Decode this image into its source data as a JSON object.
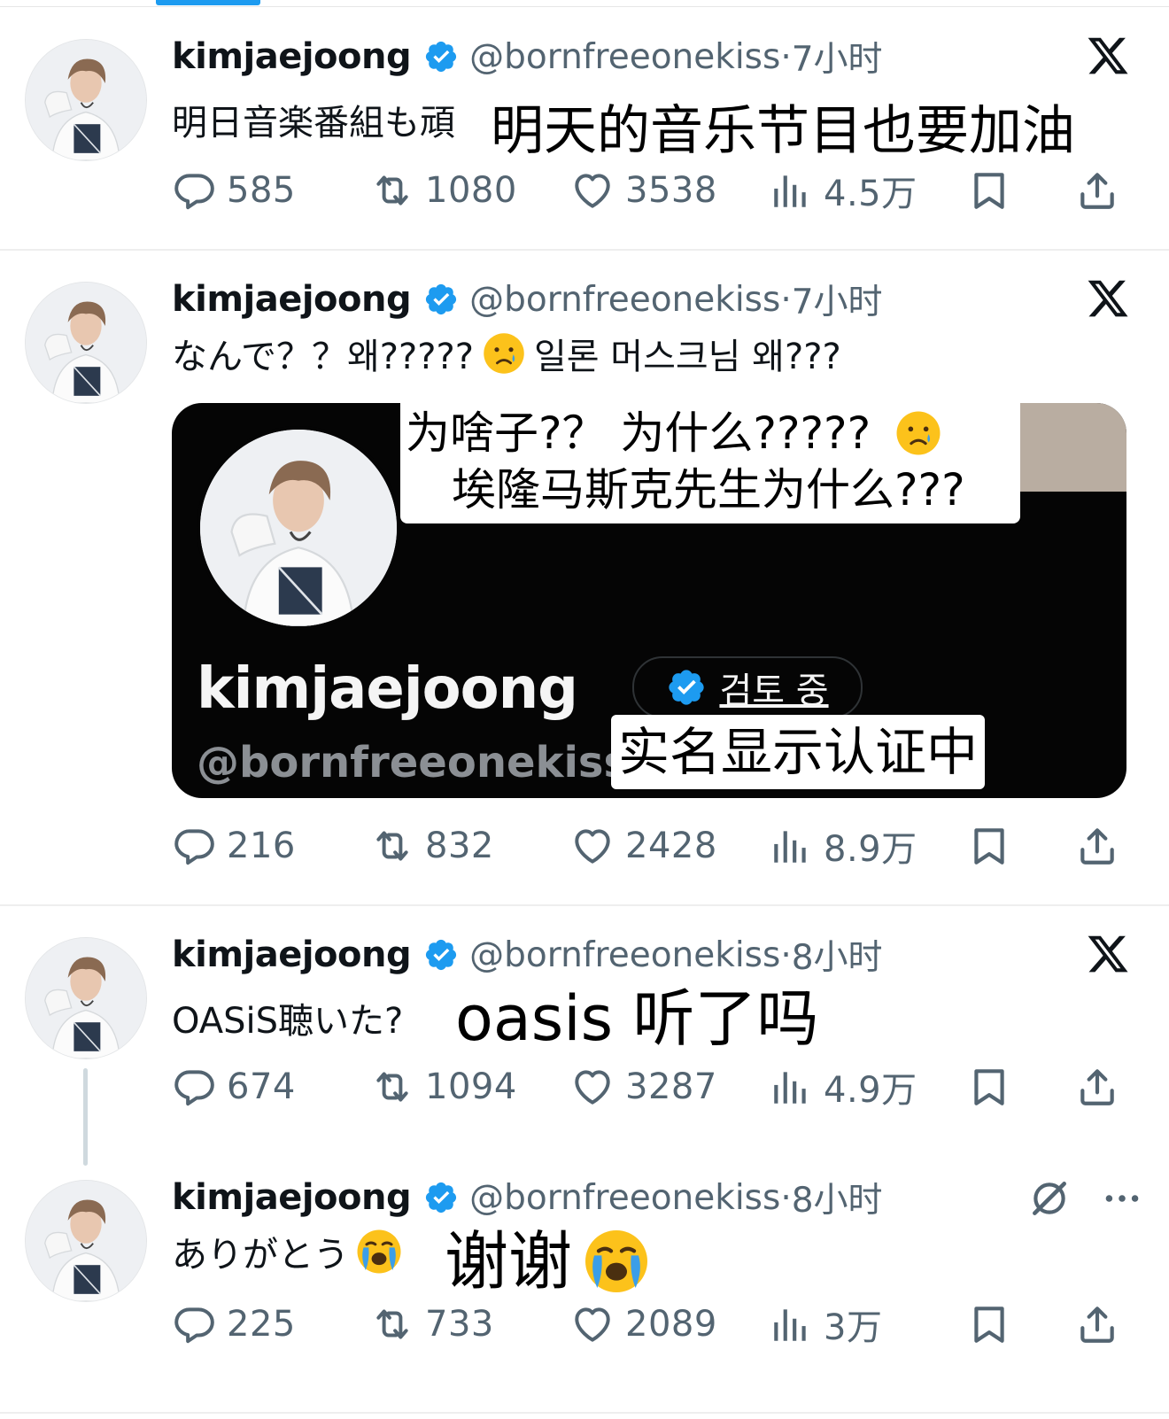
{
  "colors": {
    "accent": "#1d9bf0",
    "muted": "#536471",
    "text": "#0f1419"
  },
  "tweets": [
    {
      "name": "kimjaejoong",
      "handle": "@bornfreeonekiss",
      "time": "7小时",
      "text": "明日音楽番組も頑",
      "translation": "明天的音乐节目也要加油",
      "stats": {
        "replies": "585",
        "retweets": "1080",
        "likes": "3538",
        "views": "4.5万"
      }
    },
    {
      "name": "kimjaejoong",
      "handle": "@bornfreeonekiss",
      "time": "7小时",
      "text_a": "なんで？？왜?????",
      "text_b": "일론 머스크님 왜???",
      "card": {
        "name": "kimjaejoong",
        "handle": "@bornfreeonekiss",
        "review_label": "검토 중",
        "translation_line1": "为啥子?？ 为什么?????",
        "translation_line2": "埃隆马斯克先生为什么???",
        "badge_translation": "实名显示认证中"
      },
      "stats": {
        "replies": "216",
        "retweets": "832",
        "likes": "2428",
        "views": "8.9万"
      }
    },
    {
      "name": "kimjaejoong",
      "handle": "@bornfreeonekiss",
      "time": "8小时",
      "text": "OASiS聴いた?",
      "translation": "oasis 听了吗",
      "stats": {
        "replies": "674",
        "retweets": "1094",
        "likes": "3287",
        "views": "4.9万"
      }
    },
    {
      "name": "kimjaejoong",
      "handle": "@bornfreeonekiss",
      "time": "8小时",
      "text": "ありがとう",
      "translation": "谢谢",
      "stats": {
        "replies": "225",
        "retweets": "733",
        "likes": "2089",
        "views": "3万"
      }
    }
  ],
  "icons": [
    "verified-badge-icon",
    "x-logo-icon",
    "reply-icon",
    "retweet-icon",
    "like-icon",
    "views-icon",
    "bookmark-icon",
    "share-icon",
    "grok-icon",
    "more-icon",
    "crying-face-icon",
    "loudly-crying-face-icon"
  ]
}
